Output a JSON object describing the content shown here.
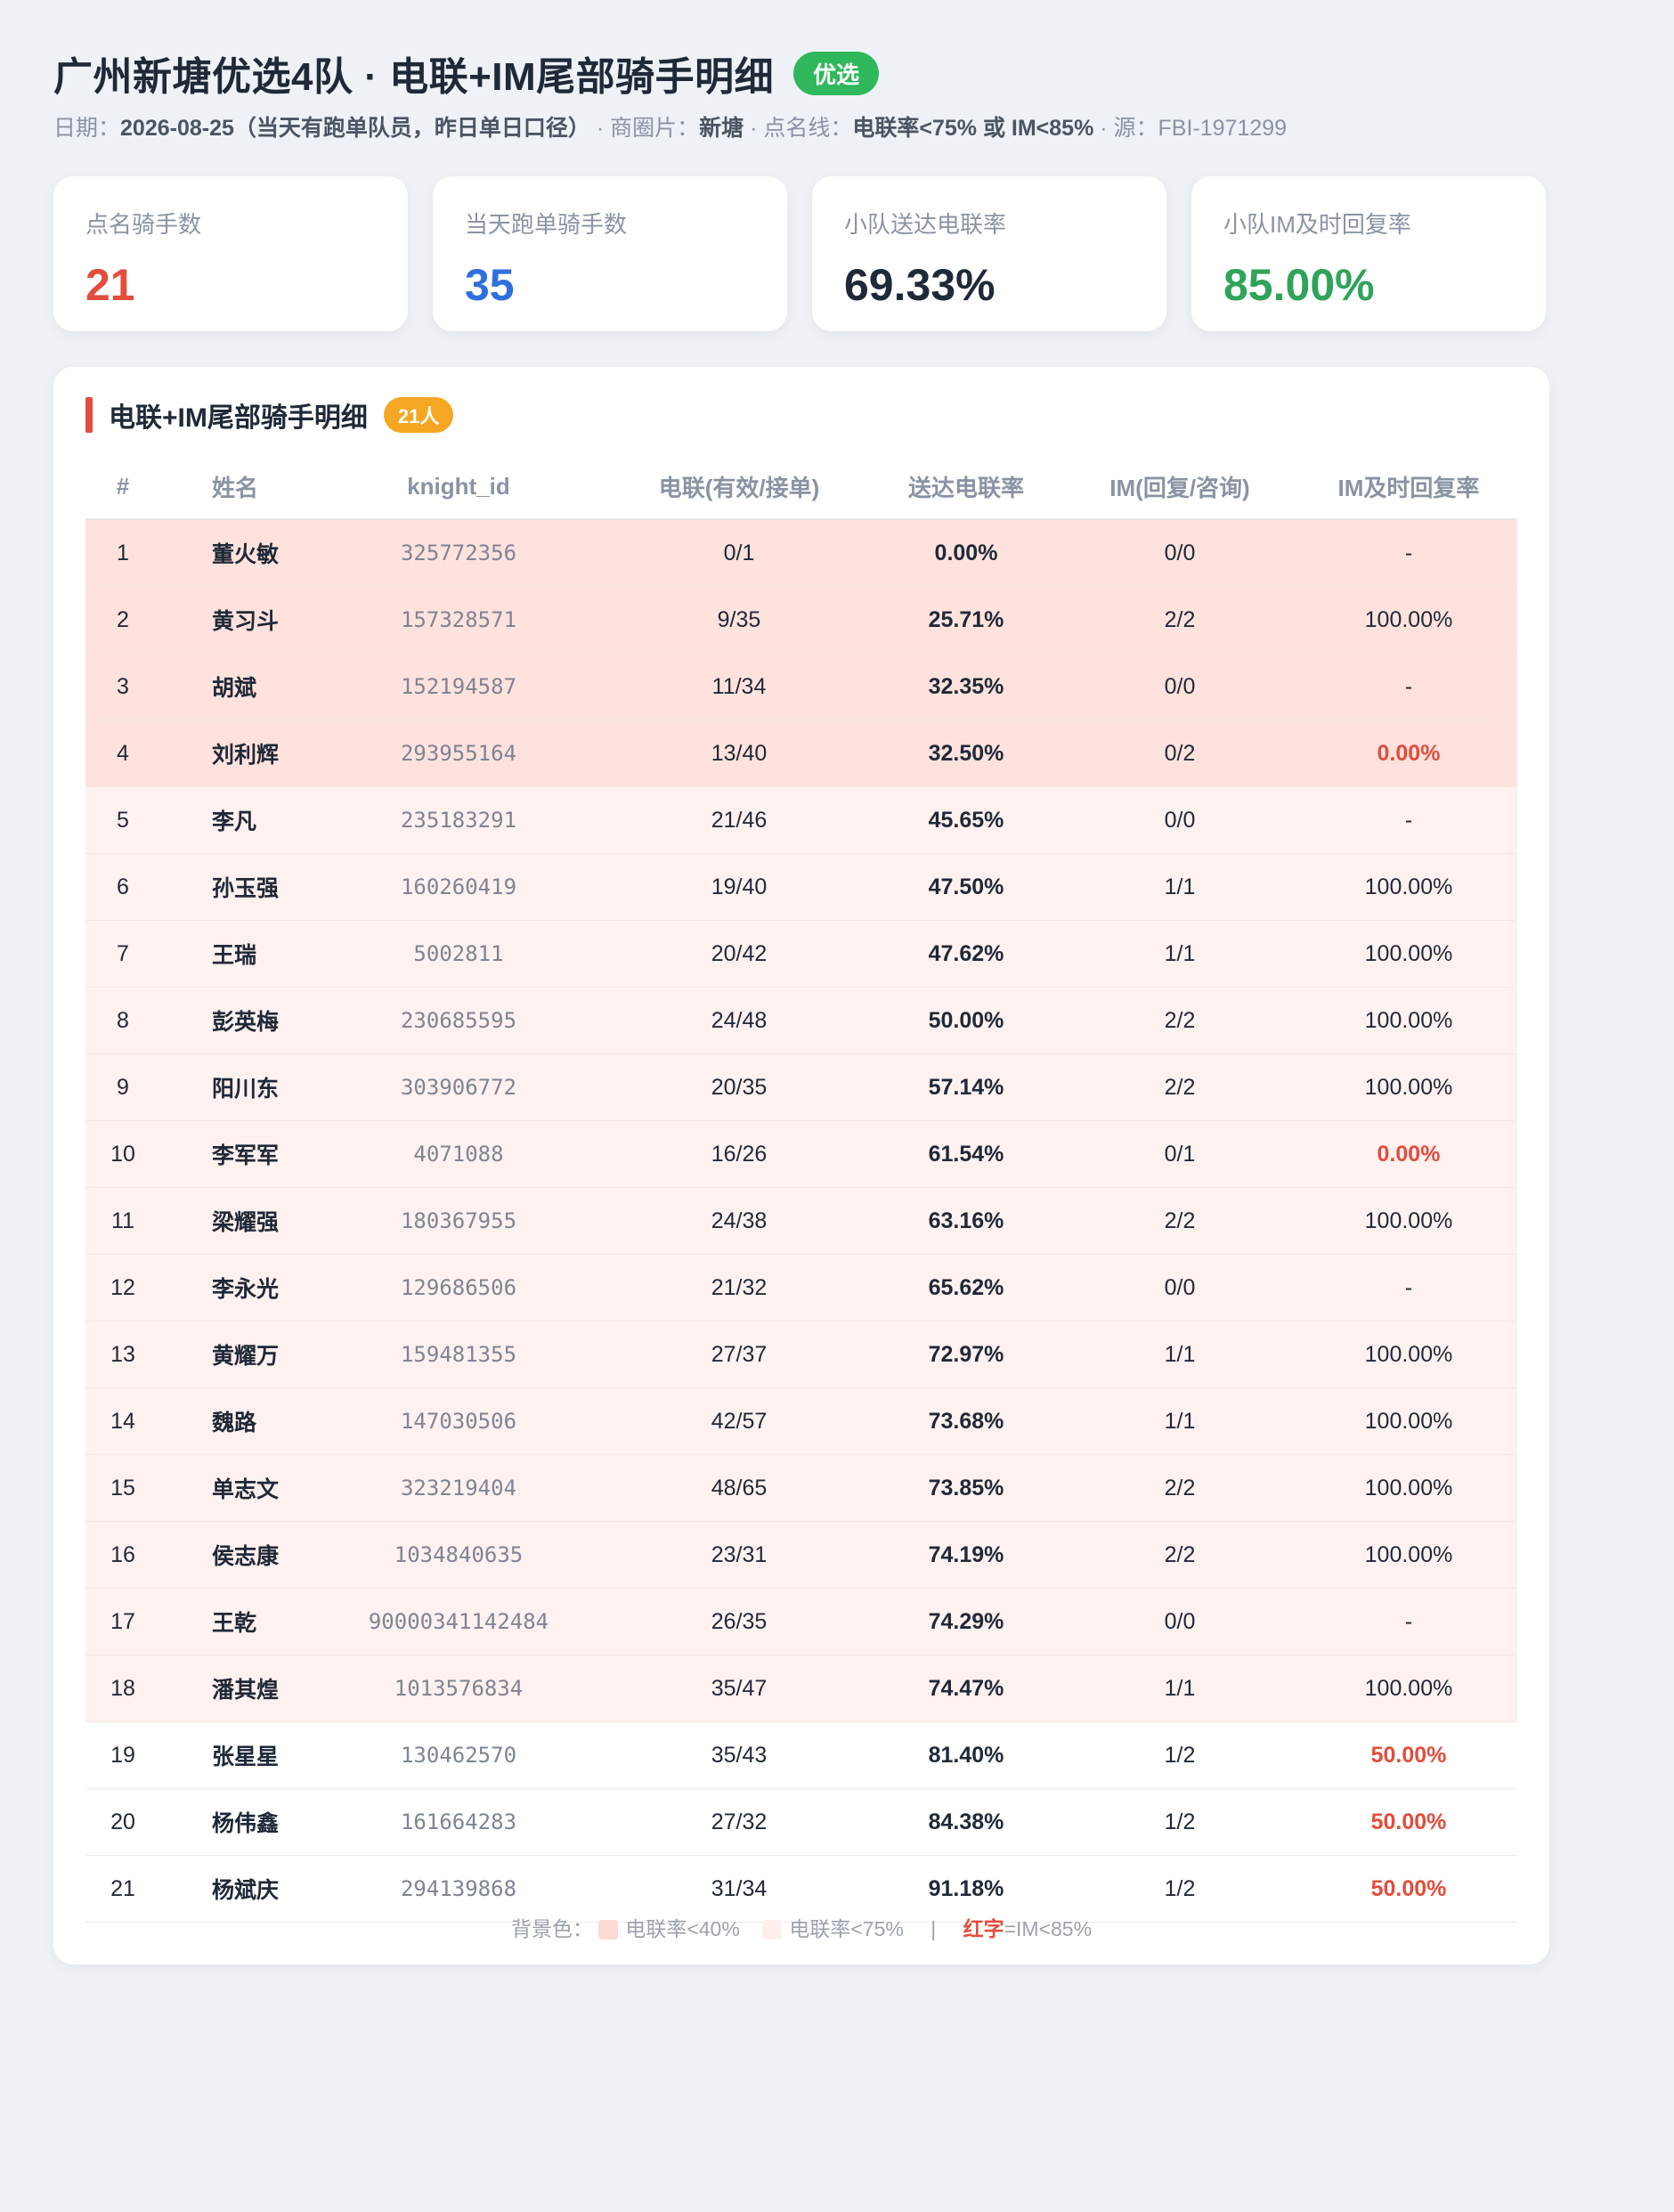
{
  "header": {
    "title": "广州新塘优选4队 · 电联+IM尾部骑手明细",
    "badge": "优选",
    "date_label": "日期：",
    "date_value": "2026-08-25（当天有跑单队员，昨日单日口径）",
    "area_label": " · 商圈片：",
    "area_value": "新塘",
    "threshold_label": " · 点名线：",
    "threshold_value": "电联率<75% 或 IM<85%",
    "source_label": " · 源：FBI-1971299"
  },
  "cards": [
    {
      "label": "点名骑手数",
      "value": "21",
      "color": "#e24d3c"
    },
    {
      "label": "当天跑单骑手数",
      "value": "35",
      "color": "#2f6fe0"
    },
    {
      "label": "小队送达电联率",
      "value": "69.33%",
      "color": "#1f2937"
    },
    {
      "label": "小队IM及时回复率",
      "value": "85.00%",
      "color": "#2fa35a"
    }
  ],
  "panel": {
    "title": "电联+IM尾部骑手明细",
    "count": "21人",
    "columns": [
      "#",
      "姓名",
      "knight_id",
      "电联(有效/接单)",
      "送达电联率",
      "IM(回复/咨询)",
      "IM及时回复率"
    ]
  },
  "rows": [
    {
      "n": "1",
      "name": "董火敏",
      "kid": "325772356",
      "call": "0/1",
      "rate": "0.00%",
      "im": "0/0",
      "imrate": "-",
      "tier": "sev",
      "imred": false
    },
    {
      "n": "2",
      "name": "黄习斗",
      "kid": "157328571",
      "call": "9/35",
      "rate": "25.71%",
      "im": "2/2",
      "imrate": "100.00%",
      "tier": "sev",
      "imred": false
    },
    {
      "n": "3",
      "name": "胡斌",
      "kid": "152194587",
      "call": "11/34",
      "rate": "32.35%",
      "im": "0/0",
      "imrate": "-",
      "tier": "sev",
      "imred": false
    },
    {
      "n": "4",
      "name": "刘利辉",
      "kid": "293955164",
      "call": "13/40",
      "rate": "32.50%",
      "im": "0/2",
      "imrate": "0.00%",
      "tier": "sev",
      "imred": true
    },
    {
      "n": "5",
      "name": "李凡",
      "kid": "235183291",
      "call": "21/46",
      "rate": "45.65%",
      "im": "0/0",
      "imrate": "-",
      "tier": "mild",
      "imred": false
    },
    {
      "n": "6",
      "name": "孙玉强",
      "kid": "160260419",
      "call": "19/40",
      "rate": "47.50%",
      "im": "1/1",
      "imrate": "100.00%",
      "tier": "mild",
      "imred": false
    },
    {
      "n": "7",
      "name": "王瑞",
      "kid": "5002811",
      "call": "20/42",
      "rate": "47.62%",
      "im": "1/1",
      "imrate": "100.00%",
      "tier": "mild",
      "imred": false
    },
    {
      "n": "8",
      "name": "彭英梅",
      "kid": "230685595",
      "call": "24/48",
      "rate": "50.00%",
      "im": "2/2",
      "imrate": "100.00%",
      "tier": "mild",
      "imred": false
    },
    {
      "n": "9",
      "name": "阳川东",
      "kid": "303906772",
      "call": "20/35",
      "rate": "57.14%",
      "im": "2/2",
      "imrate": "100.00%",
      "tier": "mild",
      "imred": false
    },
    {
      "n": "10",
      "name": "李军军",
      "kid": "4071088",
      "call": "16/26",
      "rate": "61.54%",
      "im": "0/1",
      "imrate": "0.00%",
      "tier": "mild",
      "imred": true
    },
    {
      "n": "11",
      "name": "梁耀强",
      "kid": "180367955",
      "call": "24/38",
      "rate": "63.16%",
      "im": "2/2",
      "imrate": "100.00%",
      "tier": "mild",
      "imred": false
    },
    {
      "n": "12",
      "name": "李永光",
      "kid": "129686506",
      "call": "21/32",
      "rate": "65.62%",
      "im": "0/0",
      "imrate": "-",
      "tier": "mild",
      "imred": false
    },
    {
      "n": "13",
      "name": "黄耀万",
      "kid": "159481355",
      "call": "27/37",
      "rate": "72.97%",
      "im": "1/1",
      "imrate": "100.00%",
      "tier": "mild",
      "imred": false
    },
    {
      "n": "14",
      "name": "魏路",
      "kid": "147030506",
      "call": "42/57",
      "rate": "73.68%",
      "im": "1/1",
      "imrate": "100.00%",
      "tier": "mild",
      "imred": false
    },
    {
      "n": "15",
      "name": "单志文",
      "kid": "323219404",
      "call": "48/65",
      "rate": "73.85%",
      "im": "2/2",
      "imrate": "100.00%",
      "tier": "mild",
      "imred": false
    },
    {
      "n": "16",
      "name": "侯志康",
      "kid": "1034840635",
      "call": "23/31",
      "rate": "74.19%",
      "im": "2/2",
      "imrate": "100.00%",
      "tier": "mild",
      "imred": false
    },
    {
      "n": "17",
      "name": "王乾",
      "kid": "90000341142484",
      "call": "26/35",
      "rate": "74.29%",
      "im": "0/0",
      "imrate": "-",
      "tier": "mild",
      "imred": false
    },
    {
      "n": "18",
      "name": "潘其煌",
      "kid": "1013576834",
      "call": "35/47",
      "rate": "74.47%",
      "im": "1/1",
      "imrate": "100.00%",
      "tier": "mild",
      "imred": false
    },
    {
      "n": "19",
      "name": "张星星",
      "kid": "130462570",
      "call": "35/43",
      "rate": "81.40%",
      "im": "1/2",
      "imrate": "50.00%",
      "tier": "none",
      "imred": true
    },
    {
      "n": "20",
      "name": "杨伟鑫",
      "kid": "161664283",
      "call": "27/32",
      "rate": "84.38%",
      "im": "1/2",
      "imrate": "50.00%",
      "tier": "none",
      "imred": true
    },
    {
      "n": "21",
      "name": "杨斌庆",
      "kid": "294139868",
      "call": "31/34",
      "rate": "91.18%",
      "im": "1/2",
      "imrate": "50.00%",
      "tier": "none",
      "imred": true
    }
  ],
  "legend": {
    "prefix": "背景色：",
    "sev_label": "电联率<40%",
    "sev_color": "#ffd9d3",
    "mild_label": "电联率<75%",
    "mild_color": "#ffeeec",
    "sep": "|",
    "red_word": "红字",
    "red_rest": "=IM<85%"
  }
}
